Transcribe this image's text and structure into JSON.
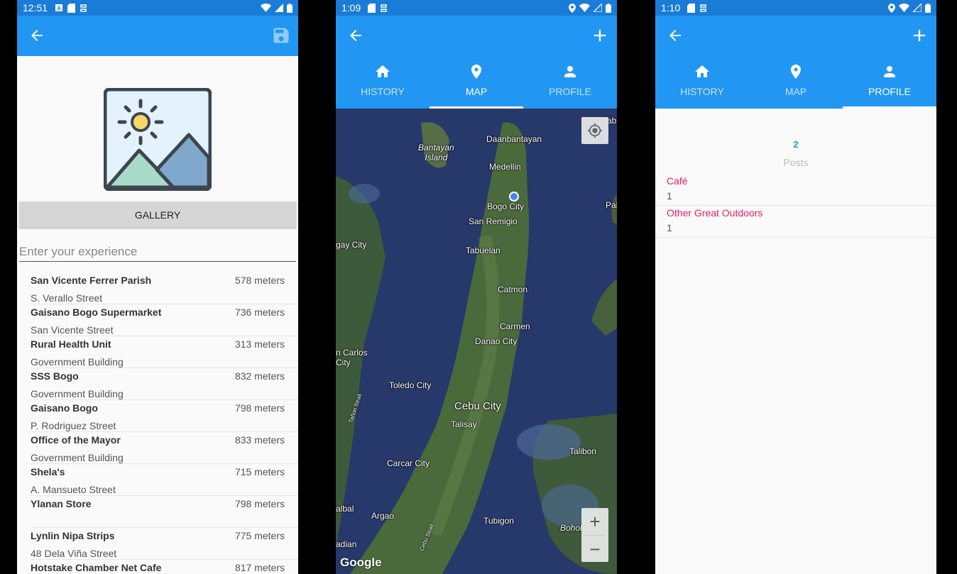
{
  "screen1": {
    "status": {
      "time": "12:51"
    },
    "gallery_label": "GALLERY",
    "input_placeholder": "Enter your experience",
    "places": [
      {
        "name": "San Vicente Ferrer Parish",
        "distance": "578 meters",
        "address": "S. Verallo Street"
      },
      {
        "name": "Gaisano Bogo Supermarket",
        "distance": "736 meters",
        "address": "San Vicente Street"
      },
      {
        "name": "Rural Health Unit",
        "distance": "313 meters",
        "address": "Government Building"
      },
      {
        "name": "SSS Bogo",
        "distance": "832 meters",
        "address": "Government Building"
      },
      {
        "name": "Gaisano Bogo",
        "distance": "798 meters",
        "address": "P. Rodriguez Street"
      },
      {
        "name": "Office of the Mayor",
        "distance": "833 meters",
        "address": "Government Building"
      },
      {
        "name": "Shela's",
        "distance": "715 meters",
        "address": "A. Mansueto Street"
      },
      {
        "name": "Ylanan Store",
        "distance": "798 meters",
        "address": ""
      },
      {
        "name": "Lynlin Nipa Strips",
        "distance": "775 meters",
        "address": "48 Dela Viña Street"
      },
      {
        "name": "Hotstake Chamber Net Cafe",
        "distance": "817 meters",
        "address": ""
      }
    ]
  },
  "screen2": {
    "status": {
      "time": "1:09"
    },
    "tabs": [
      "HISTORY",
      "MAP",
      "PROFILE"
    ],
    "map_labels": {
      "bantayan": "Bantayan\nIsland",
      "daanbantayan": "Daanbantayan",
      "medellin": "Medellin",
      "bogo": "Bogo City",
      "san_remigio": "San Remigio",
      "tabuelan": "Tabuelan",
      "catmon": "Catmon",
      "carmen": "Carmen",
      "danao": "Danao City",
      "toledo": "Toledo City",
      "cebu": "Cebu City",
      "talisay": "Talisay",
      "talibon": "Talibon",
      "carcar": "Carcar City",
      "argao": "Argao",
      "tubigon": "Tubigon",
      "gay_city": "gay City",
      "san_carlos": "n Carlos\nCity",
      "albal": "albal",
      "adian": "adian",
      "bohol": "Bohol",
      "tab": "Taba",
      "pal": "Pal",
      "tanon": "Tañon Strait",
      "cebu_strait": "Cebu Strait"
    },
    "google": "Google",
    "zoom_in": "+",
    "zoom_out": "−"
  },
  "screen3": {
    "status": {
      "time": "1:10"
    },
    "tabs": [
      "HISTORY",
      "MAP",
      "PROFILE"
    ],
    "post_count": "2",
    "post_label": "Posts",
    "categories": [
      {
        "name": "Café",
        "count": "1"
      },
      {
        "name": "Other Great Outdoors",
        "count": "1"
      }
    ]
  },
  "colors": {
    "primary": "#2196f3",
    "status": "#1a7cd6",
    "accent": "#e91e63"
  }
}
